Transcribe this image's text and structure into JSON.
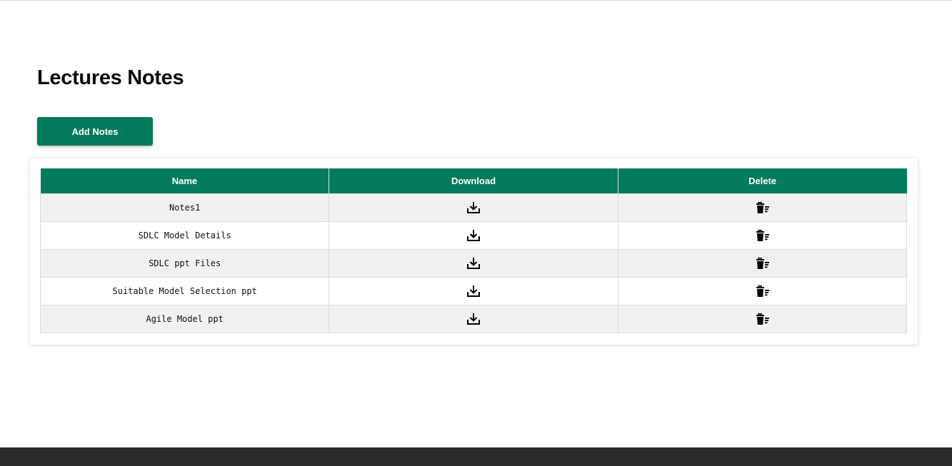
{
  "page": {
    "title": "Lectures Notes",
    "add_button_label": "Add Notes"
  },
  "table": {
    "headers": [
      "Name",
      "Download",
      "Delete"
    ],
    "rows": [
      {
        "name": "Notes1"
      },
      {
        "name": "SDLC Model Details"
      },
      {
        "name": "SDLC ppt Files"
      },
      {
        "name": "Suitable Model Selection ppt"
      },
      {
        "name": "Agile Model ppt"
      }
    ]
  },
  "icons": {
    "download": "download-icon",
    "delete": "trash-list-icon"
  },
  "colors": {
    "accent": "#047b5c",
    "footer": "#2b2b2d",
    "row_alt": "#f1f1f1"
  }
}
